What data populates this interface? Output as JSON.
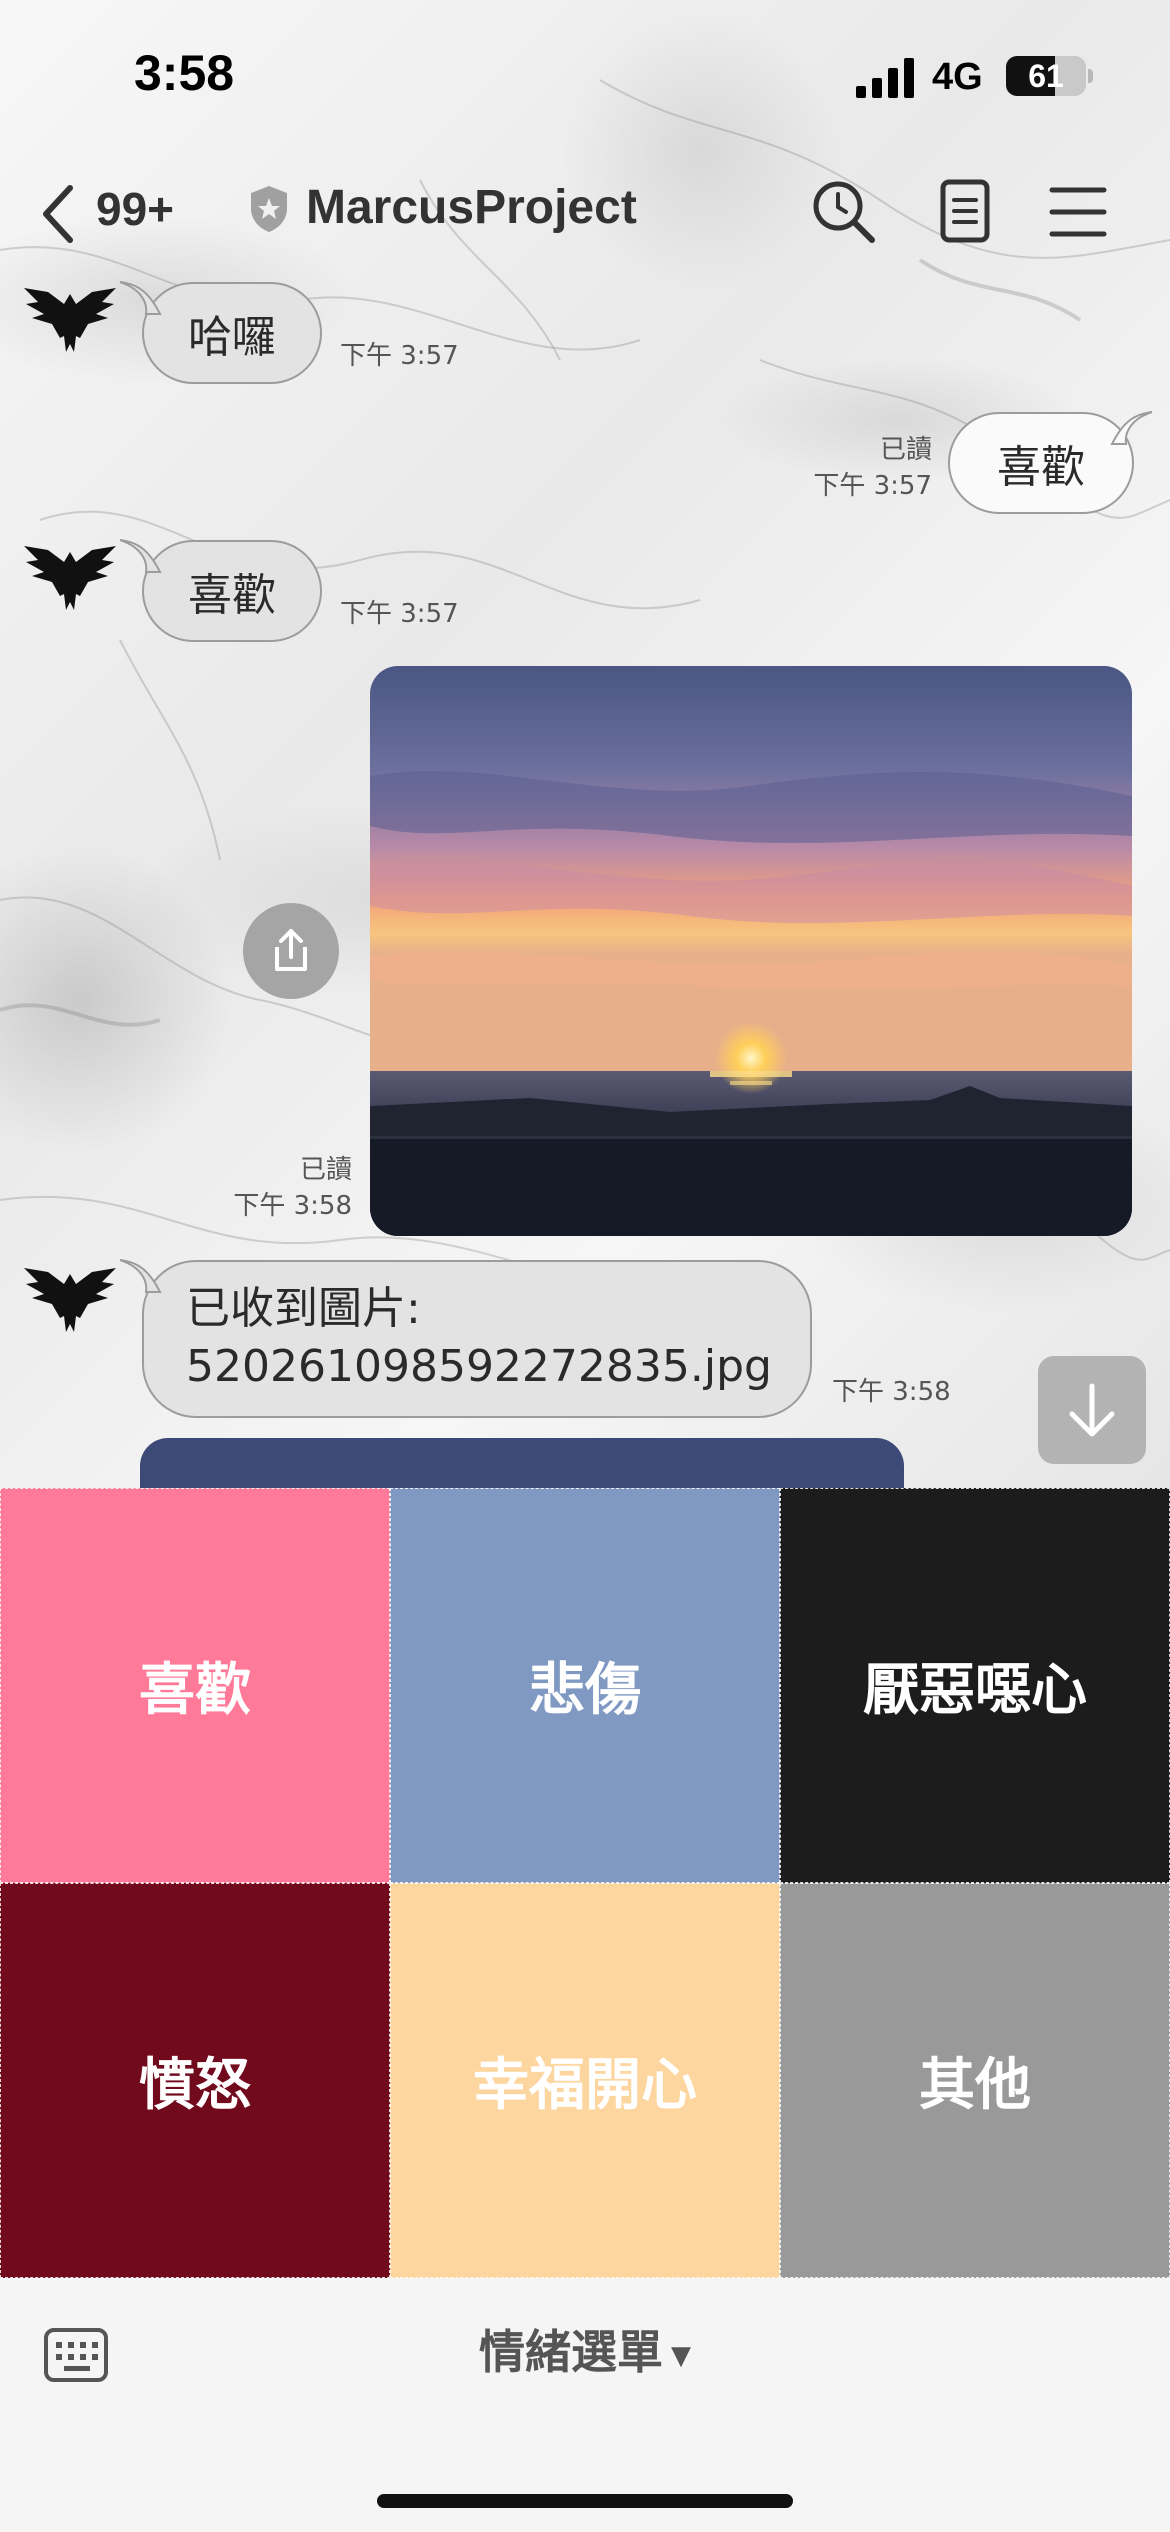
{
  "status_bar": {
    "time": "3:58",
    "network": "4G",
    "battery_level": "61",
    "battery_fraction": 0.61,
    "signal_bars": 4
  },
  "header": {
    "back_count": "99+",
    "title": "MarcusProject",
    "icons": [
      "search-icon",
      "notes-icon",
      "menu-icon"
    ]
  },
  "messages": [
    {
      "direction": "in",
      "text": "哈囉",
      "time": "下午 3:57"
    },
    {
      "direction": "out",
      "text": "喜歡",
      "read": "已讀",
      "time": "下午 3:57"
    },
    {
      "direction": "in",
      "text": "喜歡",
      "time": "下午 3:57"
    },
    {
      "direction": "out",
      "type": "image",
      "read": "已讀",
      "time": "下午 3:58"
    },
    {
      "direction": "in",
      "text_line1": "已收到圖片:",
      "text_line2": "5202610985922728​35.jpg",
      "time": "下午 3:58"
    }
  ],
  "emotion_menu": {
    "title": "情緒選單",
    "items": [
      {
        "label": "喜歡",
        "color": "#FF7A98"
      },
      {
        "label": "悲傷",
        "color": "#7F99C2"
      },
      {
        "label": "厭惡噁心",
        "color": "#1C1C1C"
      },
      {
        "label": "憤怒",
        "color": "#720A1E"
      },
      {
        "label": "幸福開心",
        "color": "#FDD59E"
      },
      {
        "label": "其他",
        "color": "#999999"
      }
    ]
  },
  "colors": {
    "incoming_bubble": "#E3E3E3",
    "outgoing_bubble": "#FAFAFA",
    "text": "#333333"
  }
}
